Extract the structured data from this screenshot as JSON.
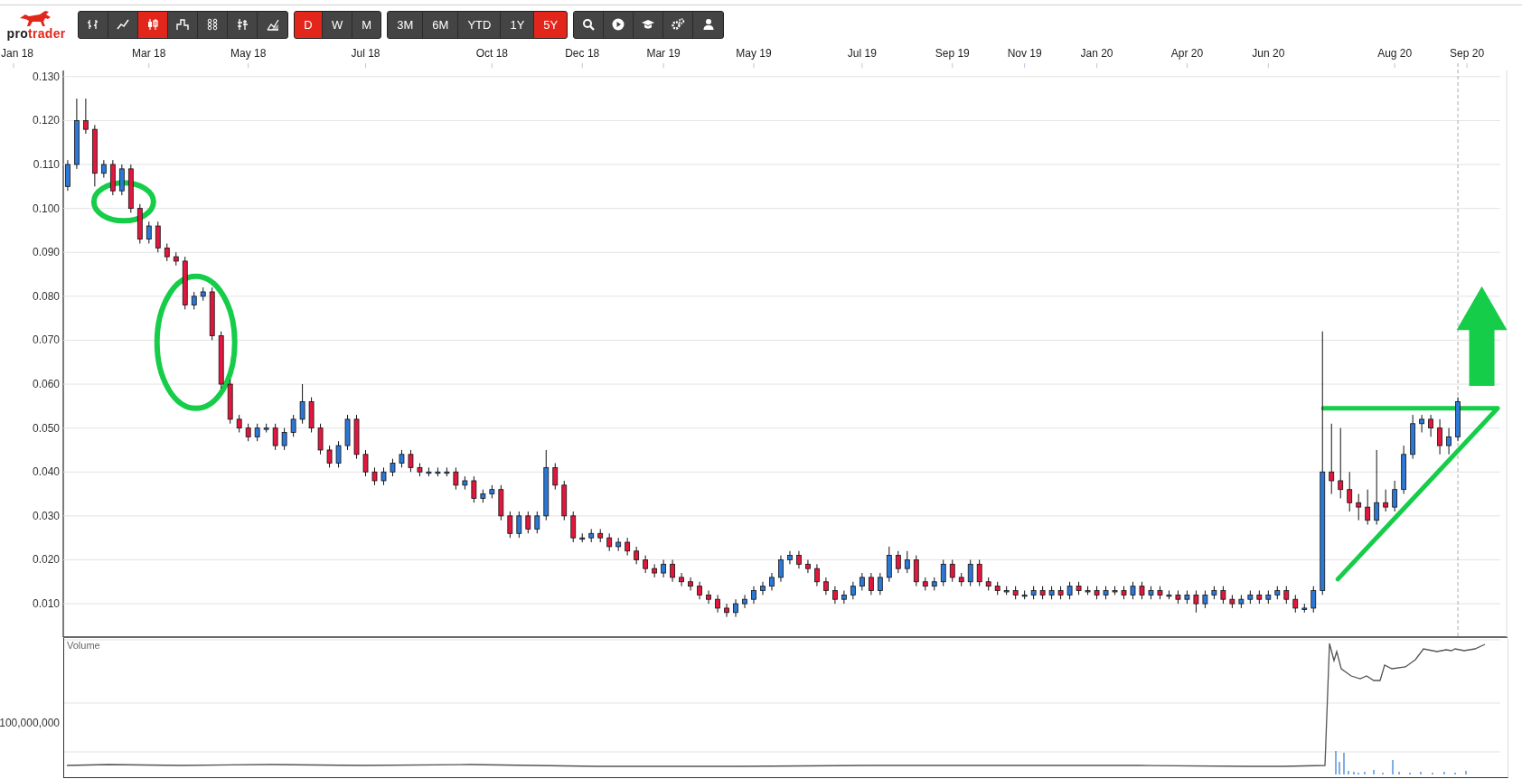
{
  "toolbar": {
    "logo": {
      "text_dark": "pro",
      "text_accent": "trader"
    },
    "chart_types": [
      {
        "kind": "ohlc",
        "selected": false
      },
      {
        "kind": "line",
        "selected": false
      },
      {
        "kind": "candle",
        "selected": true
      },
      {
        "kind": "step",
        "selected": false
      },
      {
        "kind": "points",
        "selected": false
      },
      {
        "kind": "hlc",
        "selected": false
      },
      {
        "kind": "mountain",
        "selected": false
      }
    ],
    "intervals": [
      {
        "label": "D",
        "selected": true
      },
      {
        "label": "W",
        "selected": false
      },
      {
        "label": "M",
        "selected": false
      }
    ],
    "ranges": [
      {
        "label": "3M",
        "selected": false
      },
      {
        "label": "6M",
        "selected": false
      },
      {
        "label": "YTD",
        "selected": false
      },
      {
        "label": "1Y",
        "selected": false
      },
      {
        "label": "5Y",
        "selected": true
      }
    ],
    "tools": [
      {
        "kind": "search"
      },
      {
        "kind": "play"
      },
      {
        "kind": "learn"
      },
      {
        "kind": "settings"
      },
      {
        "kind": "account"
      }
    ]
  },
  "chart": {
    "chart_data": {
      "type": "candlestick",
      "grid": true,
      "ylim": [
        0.0024,
        0.1314
      ],
      "categories": [
        null,
        "Jan 18",
        null,
        null,
        null,
        null,
        null,
        null,
        null,
        null,
        null,
        null,
        null,
        null,
        null,
        null,
        "Mar 18",
        null,
        null,
        null,
        null,
        null,
        null,
        null,
        null,
        null,
        null,
        "May 18",
        null,
        null,
        null,
        null,
        null,
        null,
        null,
        null,
        null,
        null,
        null,
        null,
        "Jul 18",
        null,
        null,
        null,
        null,
        null,
        null,
        null,
        null,
        null,
        null,
        null,
        null,
        null,
        "Oct 18",
        null,
        null,
        null,
        null,
        null,
        null,
        null,
        null,
        null,
        "Dec 18",
        null,
        null,
        null,
        null,
        null,
        null,
        null,
        null,
        "Mar 19",
        null,
        null,
        null,
        null,
        null,
        null,
        null,
        null,
        null,
        "May 19",
        null,
        null,
        null,
        null,
        null,
        null,
        null,
        null,
        null,
        null,
        null,
        "Jul 19",
        null,
        null,
        null,
        null,
        null,
        null,
        null,
        null,
        null,
        "Sep 19",
        null,
        null,
        null,
        null,
        null,
        null,
        null,
        "Nov 19",
        null,
        null,
        null,
        null,
        null,
        null,
        null,
        "Jan 20",
        null,
        null,
        null,
        null,
        null,
        null,
        null,
        null,
        null,
        "Apr 20",
        null,
        null,
        null,
        null,
        null,
        null,
        null,
        null,
        "Jun 20",
        null,
        null,
        null,
        null,
        null,
        null,
        null,
        null,
        null,
        null,
        null,
        null,
        null,
        "Aug 20",
        null,
        null,
        null,
        null,
        null,
        null,
        null,
        "Sep 20",
        null,
        null,
        null,
        null
      ],
      "yticks": [
        {
          "value": 0.13,
          "label": "0.130"
        },
        {
          "value": 0.12,
          "label": "0.120"
        },
        {
          "value": 0.11,
          "label": "0.110"
        },
        {
          "value": 0.1,
          "label": "0.100"
        },
        {
          "value": 0.09,
          "label": "0.090"
        },
        {
          "value": 0.08,
          "label": "0.080"
        },
        {
          "value": 0.07,
          "label": "0.070"
        },
        {
          "value": 0.06,
          "label": "0.060"
        },
        {
          "value": 0.05,
          "label": "0.050"
        },
        {
          "value": 0.04,
          "label": "0.040"
        },
        {
          "value": 0.03,
          "label": "0.030"
        },
        {
          "value": 0.02,
          "label": "0.020"
        },
        {
          "value": 0.01,
          "label": "0.010"
        }
      ],
      "ohlc": [
        null,
        null,
        null,
        null,
        null,
        null,
        null,
        [
          0.105,
          0.111,
          0.104,
          0.11
        ],
        [
          0.11,
          0.125,
          0.109,
          0.12
        ],
        [
          0.12,
          0.125,
          0.117,
          0.118
        ],
        [
          0.118,
          0.119,
          0.105,
          0.108
        ],
        [
          0.108,
          0.111,
          0.107,
          0.11
        ],
        [
          0.11,
          0.111,
          0.103,
          0.104
        ],
        [
          0.104,
          0.11,
          0.103,
          0.109
        ],
        [
          0.109,
          0.11,
          0.099,
          0.1
        ],
        [
          0.1,
          0.101,
          0.092,
          0.093
        ],
        [
          0.093,
          0.097,
          0.092,
          0.096
        ],
        [
          0.096,
          0.097,
          0.09,
          0.091
        ],
        [
          0.091,
          0.092,
          0.088,
          0.089
        ],
        [
          0.089,
          0.09,
          0.087,
          0.088
        ],
        [
          0.088,
          0.089,
          0.077,
          0.078
        ],
        [
          0.078,
          0.081,
          0.077,
          0.08
        ],
        [
          0.08,
          0.082,
          0.079,
          0.081
        ],
        [
          0.081,
          0.082,
          0.07,
          0.071
        ],
        [
          0.071,
          0.072,
          0.059,
          0.06
        ],
        [
          0.06,
          0.061,
          0.051,
          0.052
        ],
        [
          0.052,
          0.053,
          0.049,
          0.05
        ],
        [
          0.05,
          0.051,
          0.047,
          0.048
        ],
        [
          0.048,
          0.051,
          0.047,
          0.05
        ],
        [
          0.05,
          0.051,
          0.049,
          0.05
        ],
        [
          0.05,
          0.051,
          0.045,
          0.046
        ],
        [
          0.046,
          0.05,
          0.045,
          0.049
        ],
        [
          0.049,
          0.053,
          0.048,
          0.052
        ],
        [
          0.052,
          0.06,
          0.051,
          0.056
        ],
        [
          0.056,
          0.057,
          0.049,
          0.05
        ],
        [
          0.05,
          0.051,
          0.044,
          0.045
        ],
        [
          0.045,
          0.046,
          0.041,
          0.042
        ],
        [
          0.042,
          0.047,
          0.041,
          0.046
        ],
        [
          0.046,
          0.053,
          0.045,
          0.052
        ],
        [
          0.052,
          0.053,
          0.043,
          0.044
        ],
        [
          0.044,
          0.045,
          0.039,
          0.04
        ],
        [
          0.04,
          0.041,
          0.037,
          0.038
        ],
        [
          0.038,
          0.041,
          0.037,
          0.04
        ],
        [
          0.04,
          0.043,
          0.039,
          0.042
        ],
        [
          0.042,
          0.045,
          0.041,
          0.044
        ],
        [
          0.044,
          0.045,
          0.04,
          0.041
        ],
        [
          0.041,
          0.042,
          0.039,
          0.04
        ],
        [
          0.04,
          0.041,
          0.039,
          0.04
        ],
        [
          0.04,
          0.041,
          0.039,
          0.04
        ],
        [
          0.04,
          0.041,
          0.039,
          0.04
        ],
        [
          0.04,
          0.041,
          0.036,
          0.037
        ],
        [
          0.037,
          0.039,
          0.036,
          0.038
        ],
        [
          0.038,
          0.039,
          0.033,
          0.034
        ],
        [
          0.034,
          0.036,
          0.033,
          0.035
        ],
        [
          0.035,
          0.037,
          0.034,
          0.036
        ],
        [
          0.036,
          0.037,
          0.029,
          0.03
        ],
        [
          0.03,
          0.031,
          0.025,
          0.026
        ],
        [
          0.026,
          0.031,
          0.025,
          0.03
        ],
        [
          0.03,
          0.031,
          0.026,
          0.027
        ],
        [
          0.027,
          0.031,
          0.026,
          0.03
        ],
        [
          0.03,
          0.045,
          0.029,
          0.041
        ],
        [
          0.041,
          0.042,
          0.036,
          0.037
        ],
        [
          0.037,
          0.038,
          0.029,
          0.03
        ],
        [
          0.03,
          0.031,
          0.024,
          0.025
        ],
        [
          0.025,
          0.026,
          0.024,
          0.025
        ],
        [
          0.025,
          0.027,
          0.024,
          0.026
        ],
        [
          0.026,
          0.027,
          0.024,
          0.025
        ],
        [
          0.025,
          0.026,
          0.022,
          0.023
        ],
        [
          0.023,
          0.025,
          0.022,
          0.024
        ],
        [
          0.024,
          0.025,
          0.021,
          0.022
        ],
        [
          0.022,
          0.023,
          0.019,
          0.02
        ],
        [
          0.02,
          0.021,
          0.017,
          0.018
        ],
        [
          0.018,
          0.019,
          0.016,
          0.017
        ],
        [
          0.017,
          0.02,
          0.016,
          0.019
        ],
        [
          0.019,
          0.02,
          0.015,
          0.016
        ],
        [
          0.016,
          0.017,
          0.014,
          0.015
        ],
        [
          0.015,
          0.016,
          0.013,
          0.014
        ],
        [
          0.014,
          0.015,
          0.011,
          0.012
        ],
        [
          0.012,
          0.013,
          0.01,
          0.011
        ],
        [
          0.011,
          0.012,
          0.008,
          0.009
        ],
        [
          0.009,
          0.01,
          0.007,
          0.008
        ],
        [
          0.008,
          0.011,
          0.007,
          0.01
        ],
        [
          0.01,
          0.012,
          0.009,
          0.011
        ],
        [
          0.011,
          0.014,
          0.01,
          0.013
        ],
        [
          0.013,
          0.015,
          0.012,
          0.014
        ],
        [
          0.014,
          0.017,
          0.013,
          0.016
        ],
        [
          0.016,
          0.021,
          0.015,
          0.02
        ],
        [
          0.02,
          0.022,
          0.019,
          0.021
        ],
        [
          0.021,
          0.022,
          0.018,
          0.019
        ],
        [
          0.019,
          0.02,
          0.017,
          0.018
        ],
        [
          0.018,
          0.019,
          0.014,
          0.015
        ],
        [
          0.015,
          0.016,
          0.012,
          0.013
        ],
        [
          0.013,
          0.014,
          0.01,
          0.011
        ],
        [
          0.011,
          0.013,
          0.01,
          0.012
        ],
        [
          0.012,
          0.015,
          0.011,
          0.014
        ],
        [
          0.014,
          0.017,
          0.013,
          0.016
        ],
        [
          0.016,
          0.017,
          0.012,
          0.013
        ],
        [
          0.013,
          0.017,
          0.012,
          0.016
        ],
        [
          0.016,
          0.023,
          0.015,
          0.021
        ],
        [
          0.021,
          0.022,
          0.017,
          0.018
        ],
        [
          0.018,
          0.022,
          0.017,
          0.02
        ],
        [
          0.02,
          0.021,
          0.014,
          0.015
        ],
        [
          0.015,
          0.016,
          0.013,
          0.014
        ],
        [
          0.014,
          0.016,
          0.013,
          0.015
        ],
        [
          0.015,
          0.02,
          0.014,
          0.019
        ],
        [
          0.019,
          0.02,
          0.015,
          0.016
        ],
        [
          0.016,
          0.017,
          0.014,
          0.015
        ],
        [
          0.015,
          0.02,
          0.014,
          0.019
        ],
        [
          0.019,
          0.02,
          0.014,
          0.015
        ],
        [
          0.015,
          0.016,
          0.013,
          0.014
        ],
        [
          0.014,
          0.015,
          0.012,
          0.013
        ],
        [
          0.013,
          0.014,
          0.012,
          0.013
        ],
        [
          0.013,
          0.014,
          0.011,
          0.012
        ],
        [
          0.012,
          0.013,
          0.011,
          0.012
        ],
        [
          0.012,
          0.014,
          0.011,
          0.013
        ],
        [
          0.013,
          0.014,
          0.011,
          0.012
        ],
        [
          0.012,
          0.014,
          0.011,
          0.013
        ],
        [
          0.013,
          0.014,
          0.011,
          0.012
        ],
        [
          0.012,
          0.015,
          0.011,
          0.014
        ],
        [
          0.014,
          0.015,
          0.012,
          0.013
        ],
        [
          0.013,
          0.014,
          0.012,
          0.013
        ],
        [
          0.013,
          0.014,
          0.011,
          0.012
        ],
        [
          0.012,
          0.014,
          0.011,
          0.013
        ],
        [
          0.013,
          0.014,
          0.012,
          0.013
        ],
        [
          0.013,
          0.014,
          0.011,
          0.012
        ],
        [
          0.012,
          0.015,
          0.011,
          0.014
        ],
        [
          0.014,
          0.015,
          0.011,
          0.012
        ],
        [
          0.012,
          0.014,
          0.011,
          0.013
        ],
        [
          0.013,
          0.014,
          0.011,
          0.012
        ],
        [
          0.012,
          0.013,
          0.011,
          0.012
        ],
        [
          0.012,
          0.013,
          0.01,
          0.011
        ],
        [
          0.011,
          0.013,
          0.01,
          0.012
        ],
        [
          0.012,
          0.013,
          0.008,
          0.01
        ],
        [
          0.01,
          0.013,
          0.009,
          0.012
        ],
        [
          0.012,
          0.014,
          0.011,
          0.013
        ],
        [
          0.013,
          0.014,
          0.01,
          0.011
        ],
        [
          0.011,
          0.012,
          0.009,
          0.01
        ],
        [
          0.01,
          0.012,
          0.009,
          0.011
        ],
        [
          0.011,
          0.013,
          0.01,
          0.012
        ],
        [
          0.012,
          0.013,
          0.01,
          0.011
        ],
        [
          0.011,
          0.013,
          0.01,
          0.012
        ],
        [
          0.012,
          0.014,
          0.011,
          0.013
        ],
        [
          0.013,
          0.014,
          0.01,
          0.011
        ],
        [
          0.011,
          0.012,
          0.008,
          0.009
        ],
        [
          0.009,
          0.01,
          0.008,
          0.009
        ],
        [
          0.009,
          0.014,
          0.008,
          0.013
        ],
        [
          0.013,
          0.072,
          0.012,
          0.04
        ],
        [
          0.04,
          0.051,
          0.035,
          0.038
        ],
        [
          0.038,
          0.05,
          0.034,
          0.036
        ],
        [
          0.036,
          0.04,
          0.031,
          0.033
        ],
        [
          0.033,
          0.035,
          0.029,
          0.032
        ],
        [
          0.032,
          0.036,
          0.028,
          0.029
        ],
        [
          0.029,
          0.045,
          0.028,
          0.033
        ],
        [
          0.033,
          0.036,
          0.031,
          0.032
        ],
        [
          0.032,
          0.038,
          0.031,
          0.036
        ],
        [
          0.036,
          0.046,
          0.035,
          0.044
        ],
        [
          0.044,
          0.053,
          0.043,
          0.051
        ],
        [
          0.051,
          0.053,
          0.049,
          0.052
        ],
        [
          0.052,
          0.053,
          0.048,
          0.05
        ],
        [
          0.05,
          0.052,
          0.044,
          0.046
        ],
        [
          0.046,
          0.05,
          0.044,
          0.048
        ],
        [
          0.048,
          0.057,
          0.047,
          0.056
        ],
        null,
        null,
        null,
        null,
        null
      ]
    },
    "volume_panel": {
      "label": "Volume",
      "axis_label": "100,000,000"
    }
  }
}
